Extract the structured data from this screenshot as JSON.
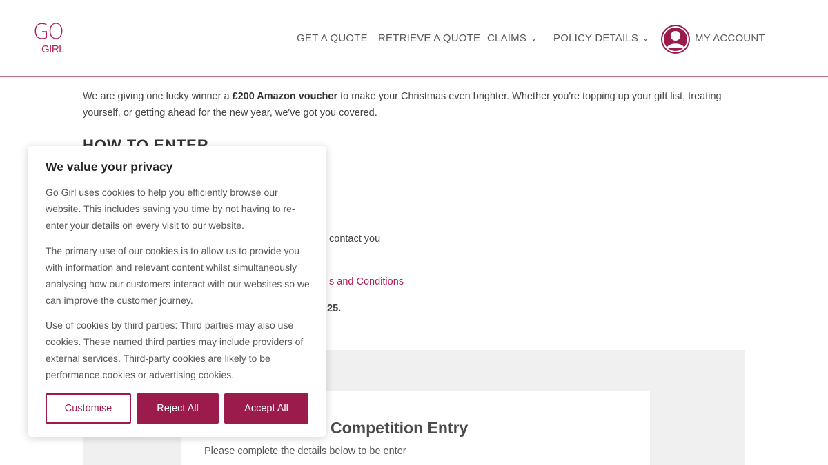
{
  "header": {
    "logo_top": "GO",
    "logo_bottom": "GIRL",
    "nav": [
      {
        "label": "GET A QUOTE"
      },
      {
        "label": "RETRIEVE A QUOTE"
      },
      {
        "label": "CLAIMS"
      },
      {
        "label": "POLICY DETAILS"
      },
      {
        "label": "MY ACCOUNT"
      }
    ],
    "chevron": "⌄"
  },
  "content": {
    "intro_pre": "We are giving one lucky winner a ",
    "intro_bold": "£200 Amazon voucher",
    "intro_post": " to make your Christmas even brighter. Whether you're topping up your gift list, treating yourself, or getting ahead for the new year, we've got you covered.",
    "section_heading": "HOW TO ENTER",
    "partial_1": "contact you",
    "partial_2": "s and Conditions",
    "partial_3": "25.",
    "form_title": "Competition Entry",
    "form_subtitle": "Please complete the details below to be enter"
  },
  "cookie": {
    "title": "We value your privacy",
    "para1": "Go Girl uses cookies to help you efficiently browse our website. This includes saving you time by not having to re-enter your details on every visit to our website.",
    "para2": "The primary use of our cookies is to allow us to provide you with information and relevant content whilst simultaneously analysing how our customers interact with our websites so we can improve the customer journey.",
    "para3": "Use of cookies by third parties: Third parties may also use cookies. These named third parties may include providers of external services. Third-party cookies are likely to be performance cookies or advertising cookies.",
    "customise_label": "Customise",
    "reject_label": "Reject All",
    "accept_label": "Accept All"
  },
  "colors": {
    "brand": "#9b1b4d",
    "link": "#b01f58",
    "panel": "#f0f0f0"
  }
}
